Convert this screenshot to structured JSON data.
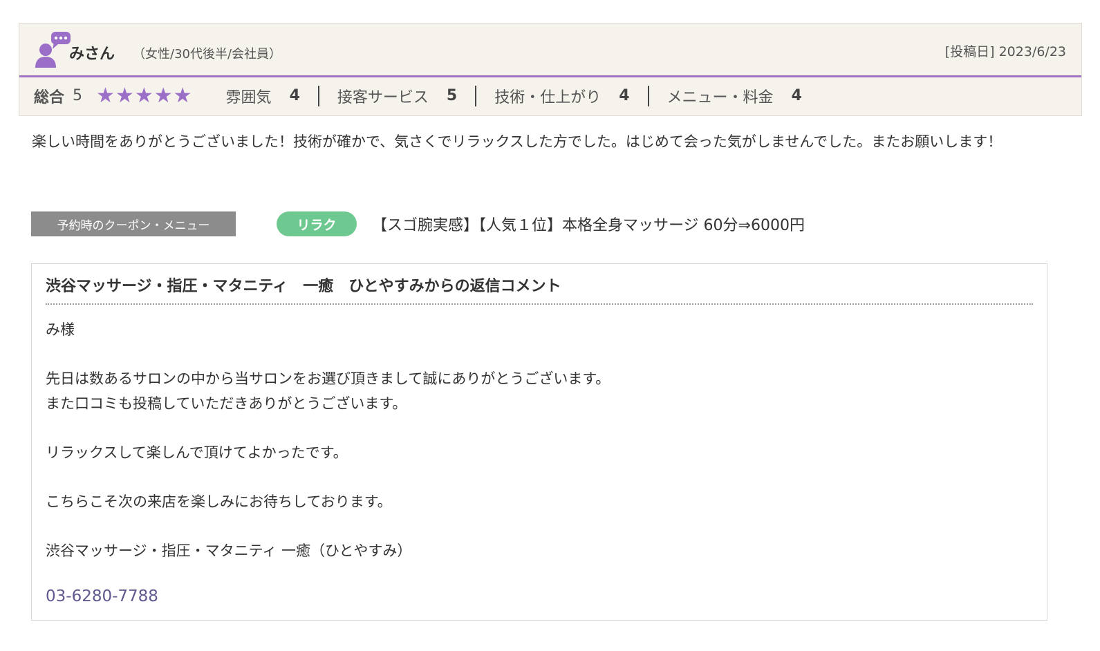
{
  "colors": {
    "accent_purple": "#a073c2",
    "star_color": "#9b6fc8",
    "coupon_tag_green": "#6dc98f",
    "phone_link": "#5f5a8e"
  },
  "review": {
    "reviewer_name": "みさん",
    "reviewer_attributes": "（女性/30代後半/会社員）",
    "post_date": "[投稿日] 2023/6/23",
    "overall_label": "総合",
    "overall_score": "5",
    "stars": 5,
    "sub_ratings": [
      {
        "label": "雰囲気",
        "value": "4"
      },
      {
        "label": "接客サービス",
        "value": "5"
      },
      {
        "label": "技術・仕上がり",
        "value": "4"
      },
      {
        "label": "メニュー・料金",
        "value": "4"
      }
    ],
    "body": "楽しい時間をありがとうございました！技術が確かで、気さくでリラックスした方でした。はじめて会った気がしませんでした。またお願いします！"
  },
  "coupon": {
    "label": "予約時のクーポン・メニュー",
    "tag": "リラク",
    "menu": "【スゴ腕実感】【人気１位】本格全身マッサージ 60分⇒6000円"
  },
  "reply": {
    "title": "渋谷マッサージ・指圧・マタニティ　一癒　ひとやすみからの返信コメント",
    "lines": [
      "み様",
      "",
      "先日は数あるサロンの中から当サロンをお選び頂きまして誠にありがとうございます。",
      "また口コミも投稿していただきありがとうございます。",
      "",
      "リラックスして楽しんで頂けてよかったです。",
      "",
      "こちらこそ次の来店を楽しみにお待ちしております。",
      "",
      "渋谷マッサージ・指圧・マタニティ 一癒（ひとやすみ）"
    ],
    "phone": "03-6280-7788"
  }
}
